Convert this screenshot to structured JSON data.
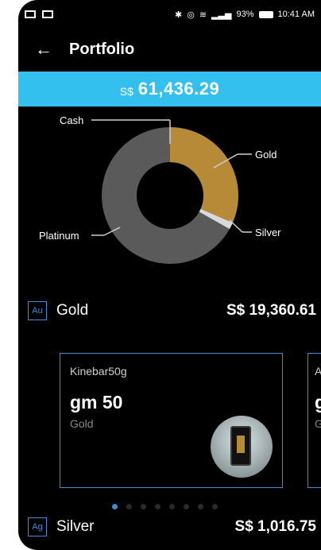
{
  "status_bar": {
    "battery": "93%",
    "time": "10:41 AM"
  },
  "app_bar": {
    "title": "Portfolio",
    "back_icon": "arrow-left-icon"
  },
  "total": {
    "currency": "S$",
    "amount": "61,436.29",
    "color": "#34c0ef"
  },
  "chart_data": {
    "type": "pie",
    "style": "donut",
    "categories": [
      "Gold",
      "Silver",
      "Platinum",
      "Cash"
    ],
    "values": [
      19360.61,
      1016.75,
      41058.93,
      0
    ],
    "colors": [
      "#b68a36",
      "#d9d9d9",
      "#5a5a5a",
      "#ffffff"
    ],
    "labels": [
      "Cash",
      "Gold",
      "Silver",
      "Platinum"
    ]
  },
  "metals": [
    {
      "symbol": "Au",
      "name": "Gold",
      "value": "S$ 19,360.61"
    },
    {
      "symbol": "Ag",
      "name": "Silver",
      "value": "S$ 1,016.75"
    }
  ],
  "cards": [
    {
      "name": "Kinebar50g",
      "qty": "gm 50",
      "metal": "Gold"
    },
    {
      "name": "A",
      "qty": "g",
      "metal": "G"
    }
  ],
  "pager": {
    "count": 8,
    "active": 0
  }
}
